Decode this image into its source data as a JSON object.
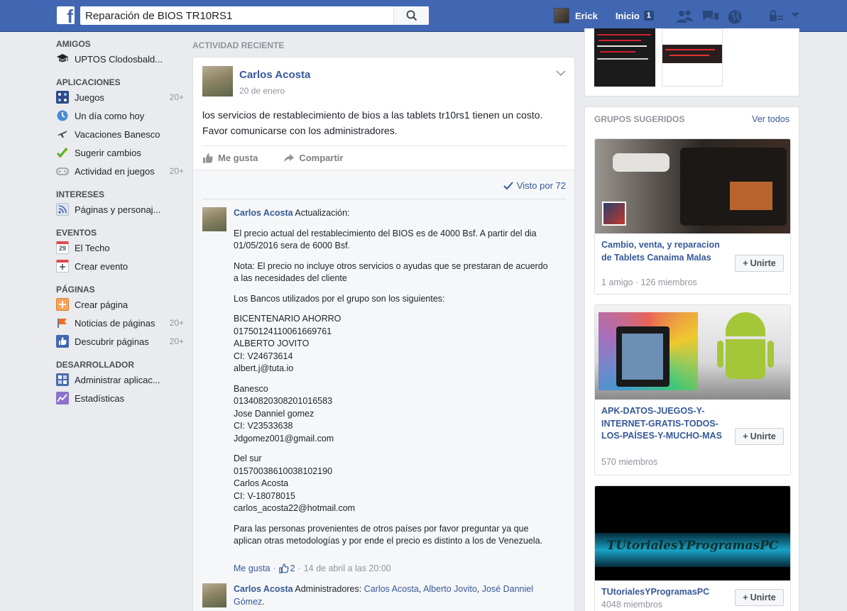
{
  "topbar": {
    "search_value": "Reparación de BIOS TR10RS1",
    "user_name": "Erick",
    "home_label": "Inicio",
    "home_count": "1"
  },
  "sidebar": {
    "sections": [
      {
        "title": "AMIGOS",
        "items": [
          {
            "label": "UPTOS Clodosbald...",
            "count": ""
          }
        ]
      },
      {
        "title": "APLICACIONES",
        "items": [
          {
            "label": "Juegos",
            "count": "20+"
          },
          {
            "label": "Un día como hoy",
            "count": ""
          },
          {
            "label": "Vacaciones Banesco",
            "count": ""
          },
          {
            "label": "Sugerir cambios",
            "count": ""
          },
          {
            "label": "Actividad en juegos",
            "count": "20+"
          }
        ]
      },
      {
        "title": "INTERESES",
        "items": [
          {
            "label": "Páginas y personaj...",
            "count": ""
          }
        ]
      },
      {
        "title": "EVENTOS",
        "items": [
          {
            "label": "El Techo",
            "count": "",
            "calendar_day": "29"
          },
          {
            "label": "Crear evento",
            "count": ""
          }
        ]
      },
      {
        "title": "PÁGINAS",
        "items": [
          {
            "label": "Crear página",
            "count": ""
          },
          {
            "label": "Noticias de páginas",
            "count": "20+"
          },
          {
            "label": "Descubrir páginas",
            "count": "20+"
          }
        ]
      },
      {
        "title": "DESARROLLADOR",
        "items": [
          {
            "label": "Administrar aplicac...",
            "count": ""
          },
          {
            "label": "Estadísticas",
            "count": ""
          }
        ]
      }
    ]
  },
  "feed": {
    "header": "ACTIVIDAD RECIENTE",
    "post": {
      "author": "Carlos Acosta",
      "date": "20 de enero",
      "text_line1": "los servicios de restablecimiento de bios a las tablets tr10rs1 tienen un costo.",
      "text_line2": "Favor comunicarse con los administradores.",
      "like_label": "Me gusta",
      "share_label": "Compartir",
      "seen_by": "Visto por 72"
    },
    "comment1": {
      "author": "Carlos Acosta",
      "lead": "Actualización:",
      "paragraphs": [
        "El precio actual del restablecimiento del BIOS es de 4000 Bsf. A partir del dia 01/05/2016 sera de 6000 Bsf.",
        "Nota: El precio no incluye otros servicios o ayudas que se prestaran de acuerdo a las necesidades del cliente",
        "Los Bancos utilizados por el grupo son los siguientes:"
      ],
      "banks": [
        [
          "BICENTENARIO AHORRO",
          "01750124110061669761",
          "ALBERTO JOVITO",
          "CI: V24673614",
          "albert.j@tuta.io"
        ],
        [
          "Banesco",
          "01340820308201016583",
          "Jose Danniel gomez",
          "CI: V23533638",
          "Jdgomez001@gmail.com"
        ],
        [
          "Del sur",
          "01570038610038102190",
          "Carlos Acosta",
          "CI: V-18078015",
          "carlos_acosta22@hotmail.com"
        ]
      ],
      "closing": "Para las personas provenientes de otros países por favor preguntar ya que aplican otras metodologías y por ende el precio es distinto a los de Venezuela.",
      "like_label": "Me gusta",
      "like_count": "2",
      "timestamp": "14 de abril a las 20:00"
    },
    "comment2": {
      "author": "Carlos Acosta",
      "lead": "Administradores:",
      "admins": [
        "Carlos Acosta",
        "Alberto Jovito",
        "José Danniel Gómez"
      ]
    }
  },
  "groups": {
    "title": "GRUPOS SUGERIDOS",
    "see_all": "Ver todos",
    "join_label": "Unirte",
    "items": [
      {
        "name": "Cambio, venta, y reparacion de Tablets Canaima Malas",
        "meta": "1 amigo · 126 miembros"
      },
      {
        "name": "APK-DATOS-JUEGOS-Y-INTERNET-GRATIS-TODOS-LOS-PAÍSES-Y-MUCHO-MAS",
        "meta": "570 miembros"
      },
      {
        "name": "TUtorialesYProgramasPC",
        "meta": "4048 miembros",
        "banner_text": "TUtorialesYProgramasPC"
      }
    ]
  },
  "colors": {
    "topbar": "#4267b2",
    "link": "#365899",
    "page_bg": "#e9ebee"
  }
}
